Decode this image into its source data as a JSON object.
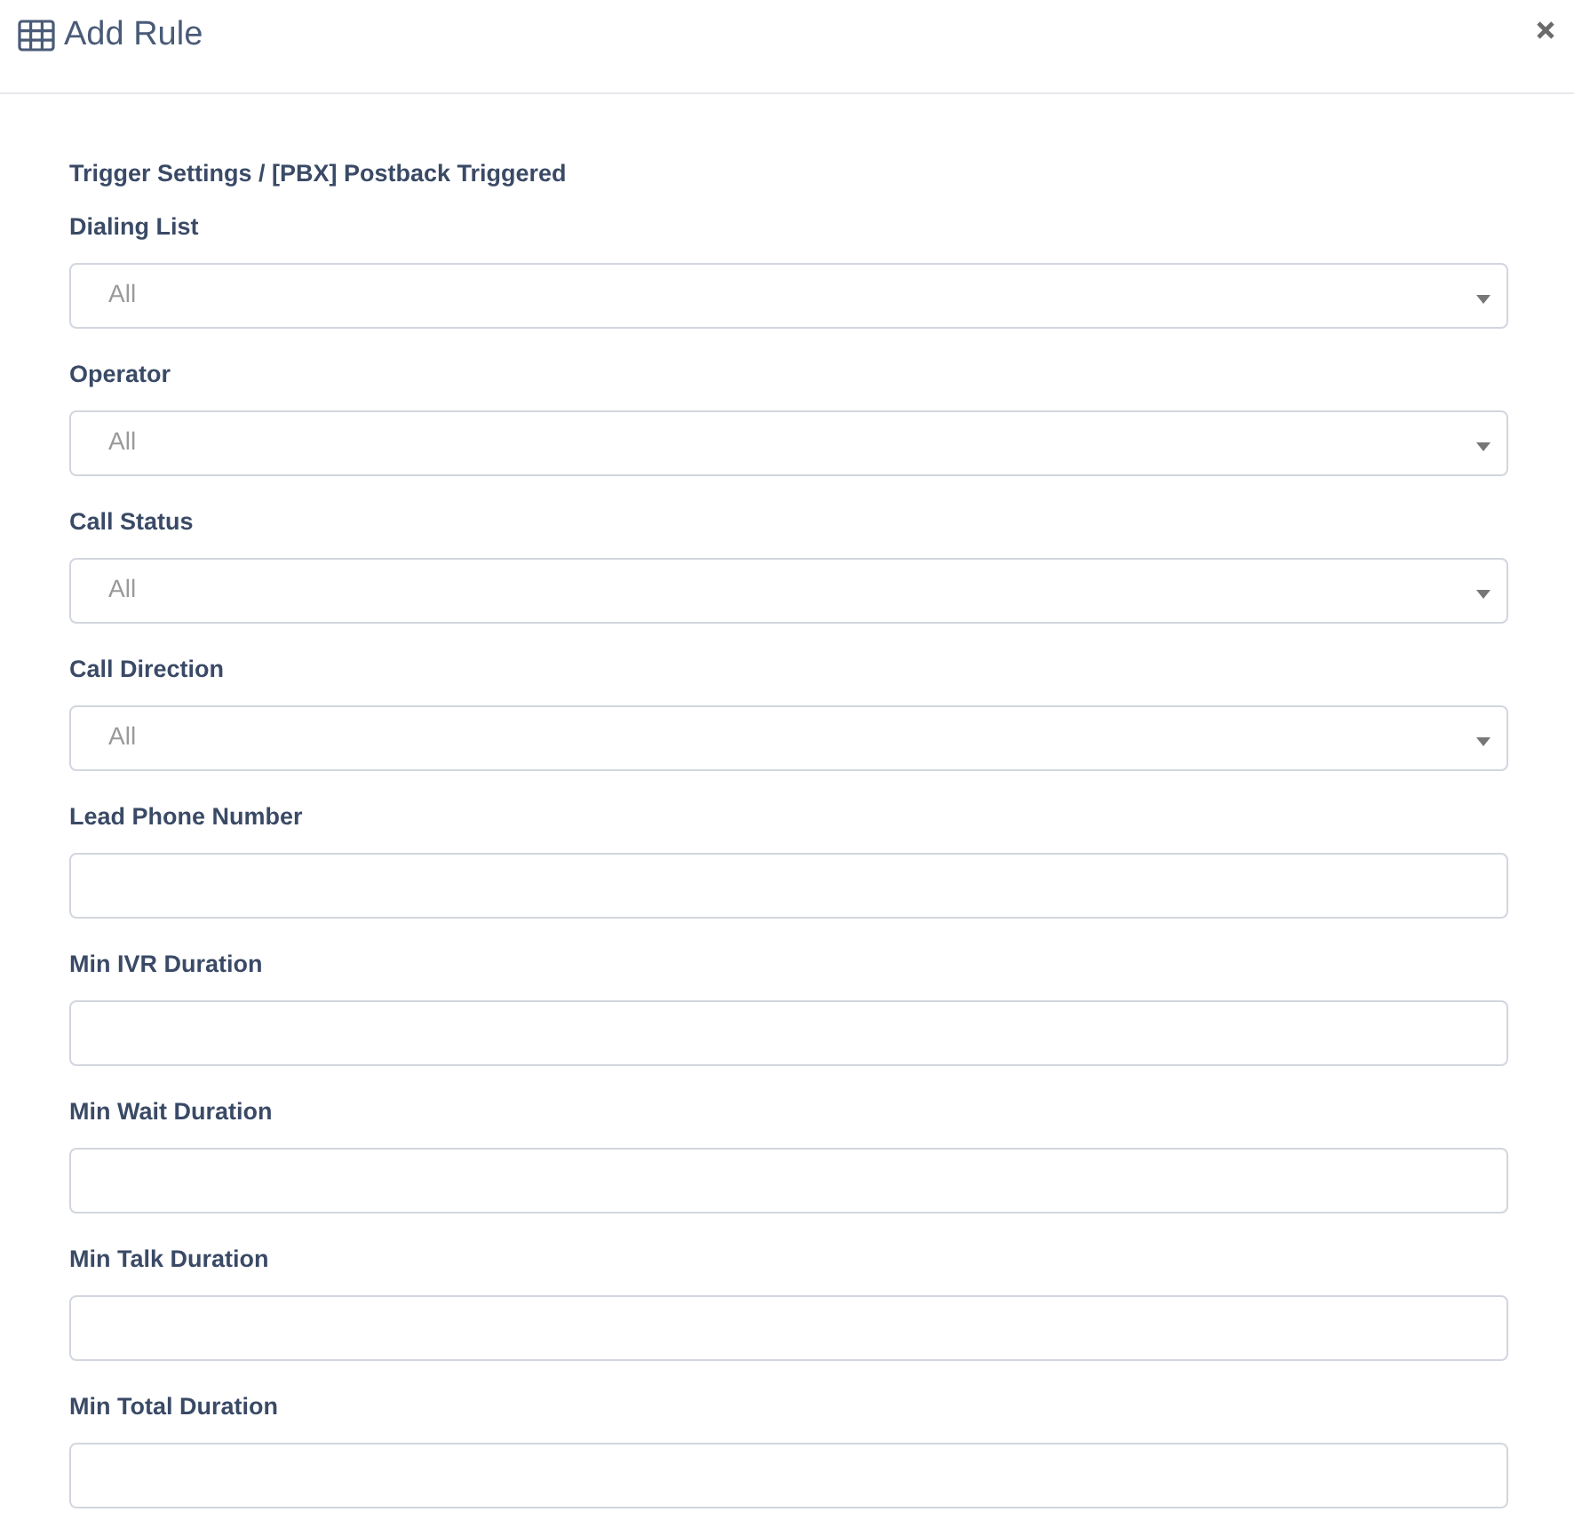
{
  "dialog": {
    "title": "Add Rule"
  },
  "section": {
    "heading": "Trigger Settings / [PBX] Postback Triggered"
  },
  "fields": [
    {
      "label": "Dialing List",
      "kind": "select",
      "placeholder": "All"
    },
    {
      "label": "Operator",
      "kind": "select",
      "placeholder": "All"
    },
    {
      "label": "Call Status",
      "kind": "select",
      "placeholder": "All"
    },
    {
      "label": "Call Direction",
      "kind": "select",
      "placeholder": "All"
    },
    {
      "label": "Lead Phone Number",
      "kind": "text"
    },
    {
      "label": "Min IVR Duration",
      "kind": "text"
    },
    {
      "label": "Min Wait Duration",
      "kind": "text"
    },
    {
      "label": "Min Talk Duration",
      "kind": "text"
    },
    {
      "label": "Min Total Duration",
      "kind": "text"
    }
  ]
}
